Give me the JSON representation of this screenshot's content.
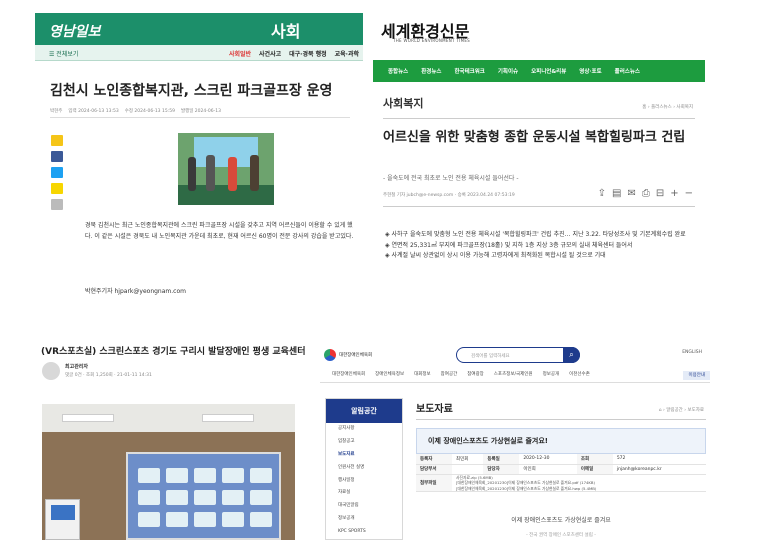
{
  "yeongnam": {
    "logo": "영남일보",
    "section": "사회",
    "all_menu": "☰ 전체보기",
    "nav": [
      "사회일반",
      "사건사고",
      "대구·경북 행정",
      "교육·과학"
    ],
    "headline": "김천시 노인종합복지관, 스크린 파크골프장 운영",
    "meta": [
      "박현주",
      "입력 2024-06-13 13:53",
      "수정 2024-06-13 15:59",
      "발행일 2024-06-13"
    ],
    "body": "경북 김천시는 최근 노인종합복지관에 스크린 파크골프장 시설을 갖추고 지역 어르신들이 이용할 수 있게 했다. 이 같은 시설은 경북도 내 노인복지관 가운데 최초로, 현재 어르신 60명이 전문 강사의 강습을 받고있다.",
    "byline": "박현주기자 hjpark@yeongnam.com",
    "share_colors": [
      "#f5c518",
      "#3b5998",
      "#1da1f2",
      "#f7d600",
      "#bbbbbb"
    ]
  },
  "segye": {
    "masthead": "세계환경신문",
    "masthead_sub": "THE WORLD ENVIRONMENT TIMES",
    "nav": [
      "종합뉴스",
      "환경뉴스",
      "한국테크워크",
      "기획이슈",
      "오피니언&리뷰",
      "영상·포토",
      "플러스뉴스"
    ],
    "category": "사회복지",
    "breadcrumb": "홈 › 플러스뉴스 › 사회복지",
    "headline": "어르신을 위한 맞춤형 종합 운동시설 복합힐링파크 건립",
    "subtitle": "- 을숙도에 전국 최초로 노인 전용 체육시설 들어선다 -",
    "meta": "주현철 기자 jubch@e-newsp.com · 승록 2023.04.24 07:53:19",
    "tools": [
      "⇪",
      "▤",
      "✉",
      "⎙",
      "⊟",
      "+",
      "−"
    ],
    "bullets": [
      "◈ 사하구 을숙도에 맞춤형 노인 전용 체육시설 '복합힐링파크' 건립 추진… 지난 3.22. 타당성조사 및 기본계획수립 완료",
      "◈ 연면적 25,331㎡ 부지에 파크골프장(18홀) 및 지하 1층 지상 3층 규모의 실내 체육센터 들어서",
      "◈ 사계절 날씨 상관없이 상시 이용 가능해 고령자에게 최적화된 복합시설 될 것으로 기대"
    ]
  },
  "vrsports": {
    "title": "(VR스포츠실) 스크린스포츠 경기도 구리시 발달장애인 평생 교육센터",
    "author": "최고관리자",
    "info": "댓글 0건 · 조회 1,250회 · 21-01-11 14:31"
  },
  "paralympic": {
    "logo": "대한장애인체육회",
    "search_placeholder": "검색어를 입력하세요",
    "lang": "ENGLISH",
    "gnb": [
      "대한장애인체육회",
      "장애인체육정보",
      "대회정보",
      "참여공간",
      "참여광장",
      "스포츠정보/국제인원",
      "정보공개",
      "이천선수촌",
      "이용안내"
    ],
    "lnb_title": "알림공간",
    "lnb_items": [
      "공지사항",
      "입찰공고",
      "보도자료",
      "인원사전 실명",
      "행사일정",
      "자료실",
      "대국민알림",
      "정보공개",
      "KPC SPORTS"
    ],
    "page_title": "보도자료",
    "breadcrumb": "⌂ › 알림공간 › 보도자료",
    "notice": "이제 장애인스포츠도 가상현실로 즐겨요!",
    "rows": [
      {
        "k": "등록자",
        "v": "최민회",
        "k2": "등록일",
        "v2": "2020-12-30",
        "k3": "조회",
        "v3": "572"
      },
      {
        "k": "담당부서",
        "v": "",
        "k2": "담당자",
        "v2": "이인희",
        "k3": "이메일",
        "v3": "jnjanh@koreanpc.kr"
      }
    ],
    "attach_label": "첨부파일",
    "attachments": [
      "사진자료.zip (5.6MB)",
      "[대한장애인체육회_20201230]이제 장애인스포츠도 가상현실로 즐겨요.pdf (174KB)",
      "[대한장애인체육회_20201230]이제 장애인스포츠도 가상현실로 즐겨요.hwp (5.4MB)"
    ],
    "body": "이제 장애인스포츠도 가상현실로 즐겨요",
    "body2": "- 전국 권역 장애인 스포츠센터 설립 -"
  }
}
